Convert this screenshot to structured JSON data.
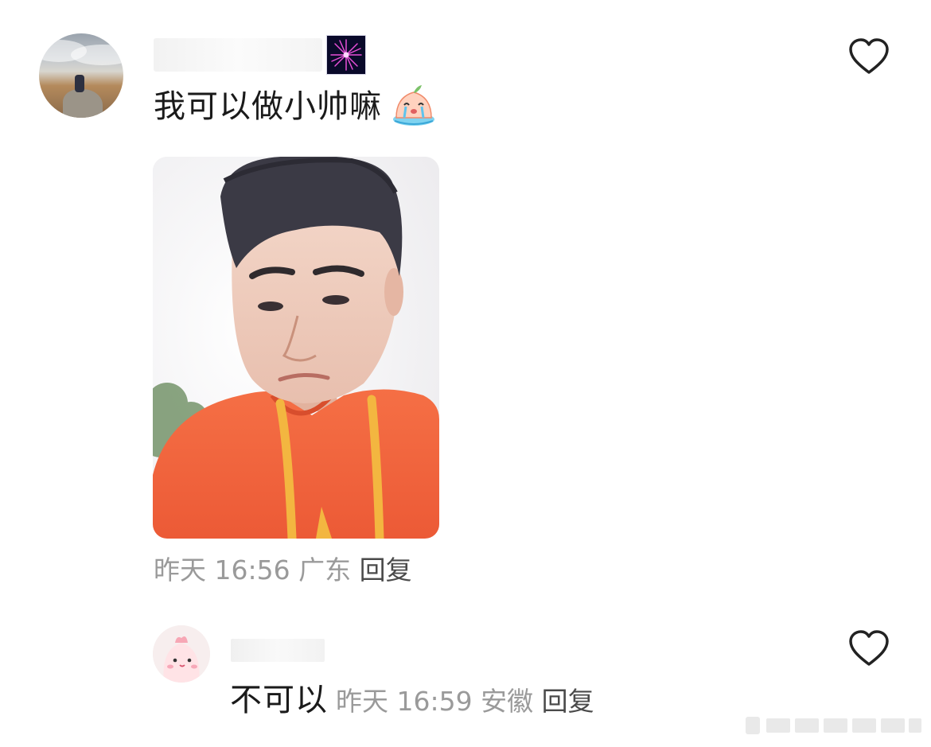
{
  "comment": {
    "text": "我可以做小帅嘛",
    "meta": {
      "time": "昨天 16:56",
      "location": "广东",
      "reply_label": "回复"
    }
  },
  "reply": {
    "text": "不可以",
    "meta": {
      "time": "昨天 16:59",
      "location": "安徽",
      "reply_label": "回复"
    }
  },
  "colors": {
    "meta_gray": "#9a9a9a",
    "text": "#1a1a1a",
    "hoodie": "#f0673c",
    "drawstring": "#f3b640"
  },
  "icons": [
    "heart-outline-icon",
    "fireworks-badge-icon",
    "crying-peach-emoji"
  ]
}
